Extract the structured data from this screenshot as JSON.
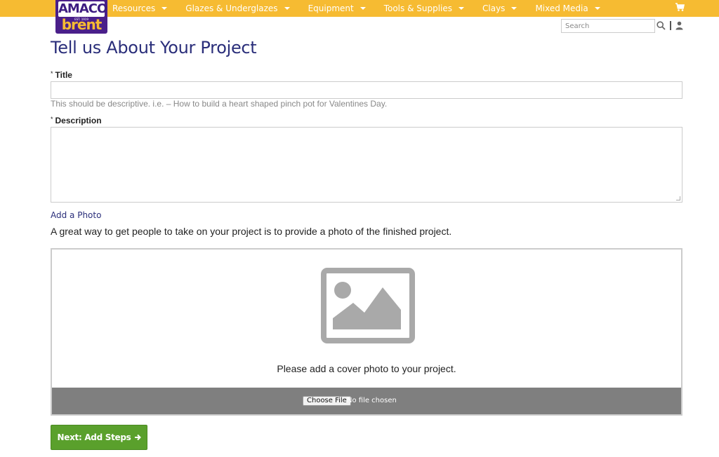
{
  "brand": {
    "name_top": "AMACO",
    "est": "EST. 1919",
    "name_bottom": "brent"
  },
  "nav": {
    "items": [
      {
        "label": "Resources"
      },
      {
        "label": "Glazes & Underglazes"
      },
      {
        "label": "Equipment"
      },
      {
        "label": "Tools & Supplies"
      },
      {
        "label": "Clays"
      },
      {
        "label": "Mixed Media"
      }
    ]
  },
  "header": {
    "search_placeholder": "Search",
    "cart_icon": "shopping-cart-icon",
    "user_icon": "user-icon"
  },
  "form": {
    "page_title": "Tell us About Your Project",
    "title_label": "Title",
    "title_value": "",
    "title_help": "This should be descriptive. i.e. – How to build a heart shaped pinch pot for Valentines Day.",
    "description_label": "Description",
    "description_value": "",
    "required_mark": "*"
  },
  "photo": {
    "heading": "Add a Photo",
    "description": "A great way to get people to take on your project is to provide a photo of the finished project.",
    "caption": "Please add a cover photo to your project.",
    "choose_file_label": "Choose File",
    "file_status": "No file chosen",
    "placeholder_icon": "image-placeholder-icon"
  },
  "actions": {
    "next_label": "Next: Add Steps"
  },
  "colors": {
    "topbar": "#f6bb32",
    "brand_purple": "#4a1f8a",
    "heading_blue": "#2a2e7a",
    "next_green": "#5aa02c",
    "file_bar": "#7f7f7f"
  }
}
